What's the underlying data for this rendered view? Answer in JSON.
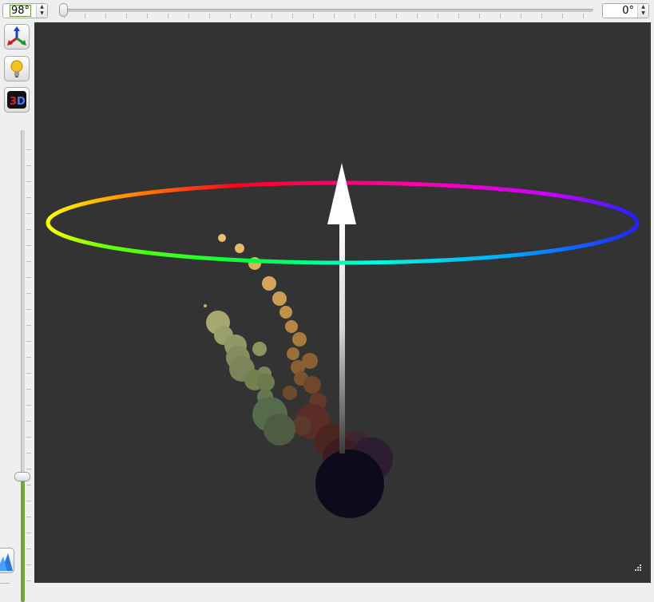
{
  "controls": {
    "vertical_angle": "98°",
    "horizontal_angle": "0°"
  },
  "toolbar": {
    "buttons": [
      "axes-view",
      "lighting",
      "3d-mode"
    ]
  },
  "scene": {
    "background": "#333333",
    "arrow_color": "#ffffff",
    "base_sphere_color": "#0d0a1c"
  }
}
